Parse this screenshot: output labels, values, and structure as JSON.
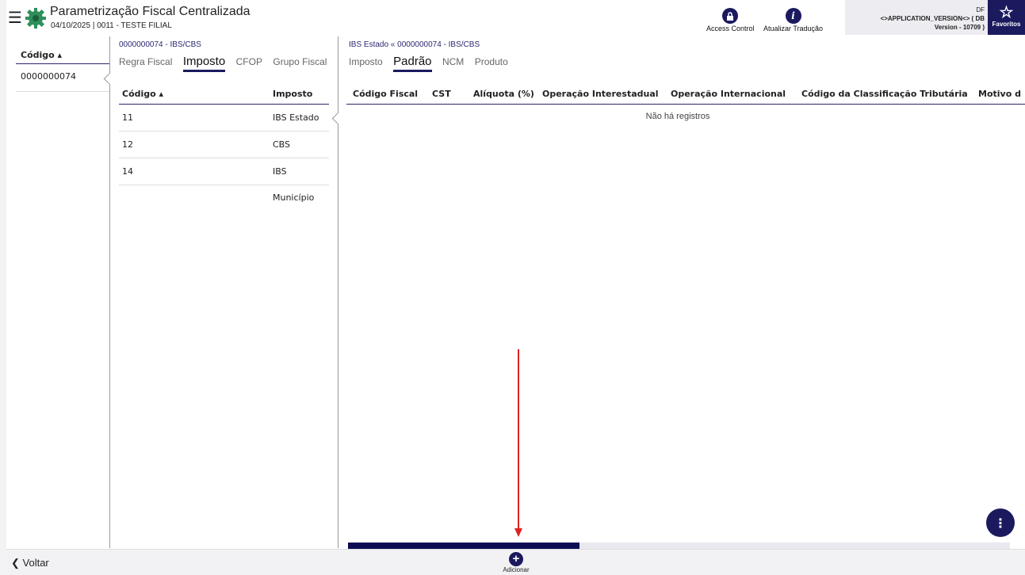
{
  "header": {
    "menu_icon": "☰",
    "title": "Parametrização Fiscal Centralizada",
    "subtitle": "04/10/2025 | 0011 - TESTE FILIAL",
    "access_control_label": "Access Control",
    "translate_label": "Atualizar Tradução",
    "version_line1": "DF",
    "version_line2": "<>APPLICATION_VERSION<> ( DB",
    "version_line3": "Version - 10709 )",
    "favorites_label": "Favoritos",
    "favorites_icon": "☆"
  },
  "panel1": {
    "column_header": "Código ▴",
    "rows": [
      "0000000074"
    ]
  },
  "panel2": {
    "breadcrumb": "0000000074 - IBS/CBS",
    "tabs": [
      "Regra Fiscal",
      "Imposto",
      "CFOP",
      "Grupo Fiscal"
    ],
    "active_tab": "Imposto",
    "columns": [
      "Código ▴",
      "Imposto"
    ],
    "rows": [
      {
        "codigo": "11",
        "imposto": "IBS Estado"
      },
      {
        "codigo": "12",
        "imposto": "CBS"
      },
      {
        "codigo": "14",
        "imposto": "IBS Município"
      }
    ]
  },
  "panel3": {
    "breadcrumb": "IBS Estado « 0000000074 - IBS/CBS",
    "tabs": [
      "Imposto",
      "Padrão",
      "NCM",
      "Produto"
    ],
    "active_tab": "Padrão",
    "columns": [
      "Código Fiscal",
      "CST",
      "Alíquota (%)",
      "Operação Interestadual",
      "Operação Internacional",
      "Código da Classificação Tributária",
      "Motivo d"
    ],
    "empty_message": "Não há registros",
    "scroll_fraction": 0.35
  },
  "fab_icon": "⋮",
  "footer": {
    "back_label": "❮ Voltar",
    "add_icon": "+",
    "add_label": "Adicionar"
  },
  "colors": {
    "primary": "#1b1a5e",
    "annotation_arrow": "#e02020"
  }
}
